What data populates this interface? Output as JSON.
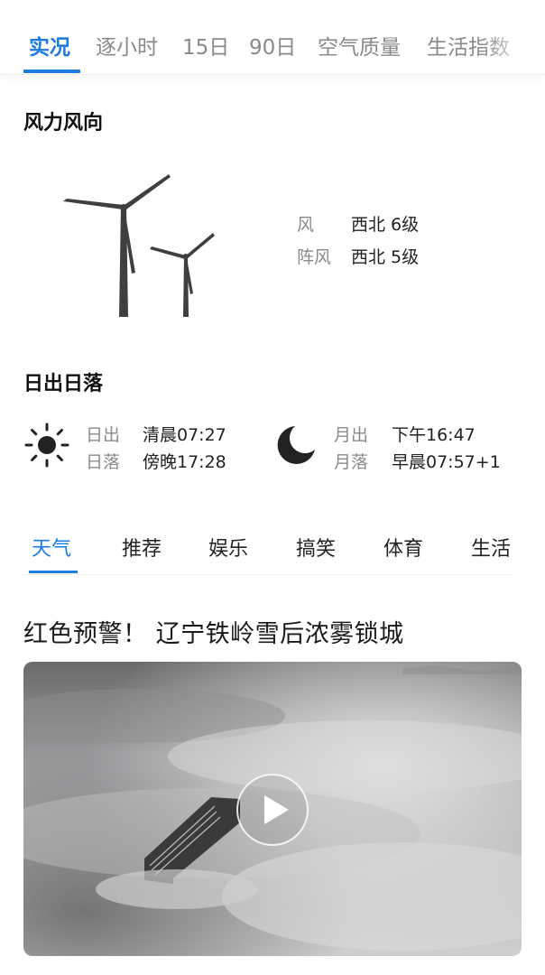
{
  "top_tabs": [
    "实况",
    "逐小时",
    "15日",
    "90日",
    "空气质量",
    "生活指数"
  ],
  "wind": {
    "title": "风力风向",
    "wind_label": "风",
    "wind_value": "西北 6级",
    "gust_label": "阵风",
    "gust_value": "西北 5级"
  },
  "sun_moon": {
    "title": "日出日落",
    "sunrise_label": "日出",
    "sunrise_value": "清晨07:27",
    "sunset_label": "日落",
    "sunset_value": "傍晚17:28",
    "moonrise_label": "月出",
    "moonrise_value": "下午16:47",
    "moonset_label": "月落",
    "moonset_value": "早晨07:57+1"
  },
  "category_tabs": [
    "天气",
    "推荐",
    "娱乐",
    "搞笑",
    "体育",
    "生活"
  ],
  "news": {
    "title": "红色预警！ 辽宁铁岭雪后浓雾锁城"
  },
  "colors": {
    "accent": "#1e7be0"
  }
}
